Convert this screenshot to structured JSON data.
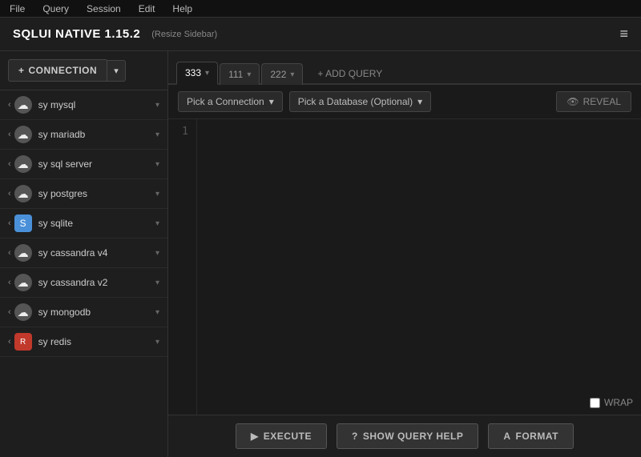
{
  "menu": {
    "items": [
      "File",
      "Query",
      "Session",
      "Edit",
      "Help"
    ]
  },
  "titlebar": {
    "title": "SQLUI NATIVE 1.15.2",
    "resize_label": "(Resize Sidebar)",
    "menu_icon": "≡"
  },
  "sidebar": {
    "connection_btn": "CONNECTION",
    "items": [
      {
        "id": "mysql",
        "label": "sy mysql",
        "icon": "cloud",
        "icon_char": "☁"
      },
      {
        "id": "mariadb",
        "label": "sy mariadb",
        "icon": "cloud",
        "icon_char": "☁"
      },
      {
        "id": "sqlserver",
        "label": "sy sql server",
        "icon": "cloud",
        "icon_char": "☁"
      },
      {
        "id": "postgres",
        "label": "sy postgres",
        "icon": "cloud",
        "icon_char": "☁"
      },
      {
        "id": "sqlite",
        "label": "sy sqlite",
        "icon": "sqlite",
        "icon_char": "S"
      },
      {
        "id": "cassandrav4",
        "label": "sy cassandra v4",
        "icon": "cloud",
        "icon_char": "☁"
      },
      {
        "id": "cassandrav2",
        "label": "sy cassandra v2",
        "icon": "cloud",
        "icon_char": "☁"
      },
      {
        "id": "mongodb",
        "label": "sy mongodb",
        "icon": "cloud",
        "icon_char": "☁"
      },
      {
        "id": "redis",
        "label": "sy redis",
        "icon": "redis",
        "icon_char": "R"
      }
    ]
  },
  "tabs": [
    {
      "id": "tab1",
      "label": "333",
      "active": true
    },
    {
      "id": "tab2",
      "label": "111",
      "active": false
    },
    {
      "id": "tab3",
      "label": "222",
      "active": false
    }
  ],
  "add_query_label": "+ ADD QUERY",
  "query_controls": {
    "connection_placeholder": "Pick a Connection",
    "database_placeholder": "Pick a Database (Optional)",
    "reveal_label": "REVEAL"
  },
  "editor": {
    "line_number": "1",
    "content": ""
  },
  "wrap_label": "WRAP",
  "toolbar": {
    "execute_label": "EXECUTE",
    "show_help_label": "SHOW QUERY HELP",
    "format_label": "FORMAT"
  }
}
